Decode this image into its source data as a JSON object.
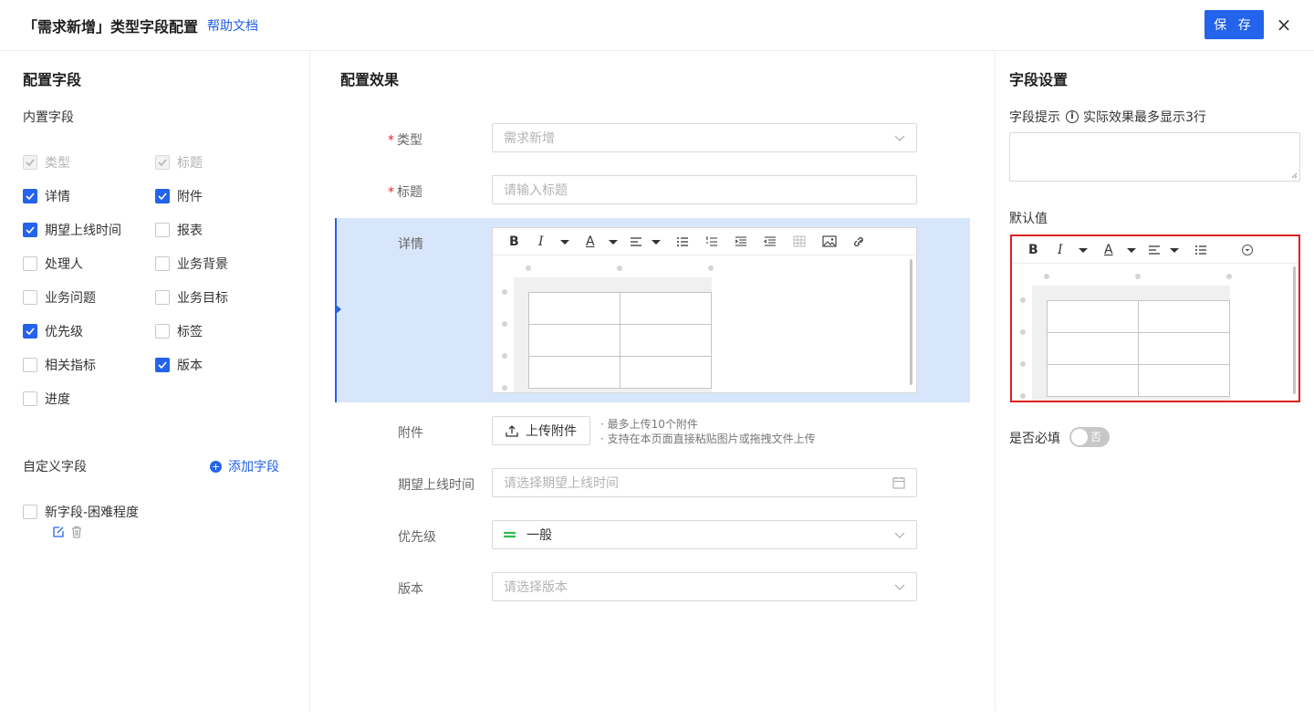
{
  "header": {
    "title": "「需求新增」类型字段配置",
    "help": "帮助文档",
    "save": "保 存",
    "close": "×"
  },
  "left": {
    "title": "配置字段",
    "builtin_title": "内置字段",
    "builtin": [
      {
        "label": "类型",
        "checked": true,
        "disabled": true
      },
      {
        "label": "标题",
        "checked": true,
        "disabled": true
      },
      {
        "label": "详情",
        "checked": true,
        "disabled": false
      },
      {
        "label": "附件",
        "checked": true,
        "disabled": false
      },
      {
        "label": "期望上线时间",
        "checked": true,
        "disabled": false
      },
      {
        "label": "报表",
        "checked": false,
        "disabled": false
      },
      {
        "label": "处理人",
        "checked": false,
        "disabled": false
      },
      {
        "label": "业务背景",
        "checked": false,
        "disabled": false
      },
      {
        "label": "业务问题",
        "checked": false,
        "disabled": false
      },
      {
        "label": "业务目标",
        "checked": false,
        "disabled": false
      },
      {
        "label": "优先级",
        "checked": true,
        "disabled": false
      },
      {
        "label": "标签",
        "checked": false,
        "disabled": false
      },
      {
        "label": "相关指标",
        "checked": false,
        "disabled": false
      },
      {
        "label": "版本",
        "checked": true,
        "disabled": false
      },
      {
        "label": "进度",
        "checked": false,
        "disabled": false
      }
    ],
    "custom_title": "自定义字段",
    "add_field": "添加字段",
    "custom": [
      {
        "label": "新字段-困难程度",
        "checked": false
      }
    ]
  },
  "middle": {
    "title": "配置效果",
    "fields": {
      "type_label": "类型",
      "type_value": "需求新增",
      "title_label": "标题",
      "title_placeholder": "请输入标题",
      "detail_label": "详情",
      "attach_label": "附件",
      "upload_btn": "上传附件",
      "upload_hint1": "· 最多上传10个附件",
      "upload_hint2": "· 支持在本页面直接粘贴图片或拖拽文件上传",
      "date_label": "期望上线时间",
      "date_placeholder": "请选择期望上线时间",
      "priority_label": "优先级",
      "priority_value": "一般",
      "version_label": "版本",
      "version_placeholder": "请选择版本"
    },
    "required_mark": "*",
    "editor_toolbar": {
      "bold": "B",
      "italic": "I",
      "color": "A"
    }
  },
  "right": {
    "title": "字段设置",
    "tip_label": "字段提示",
    "tip_note": "实际效果最多显示3行",
    "default_label": "默认值",
    "required_label": "是否必填",
    "required_value": "否"
  },
  "colors": {
    "primary": "#2463eb",
    "highlight": "#d8e6fb",
    "error_border": "#e02020",
    "priority_green": "#2dbb4e"
  }
}
